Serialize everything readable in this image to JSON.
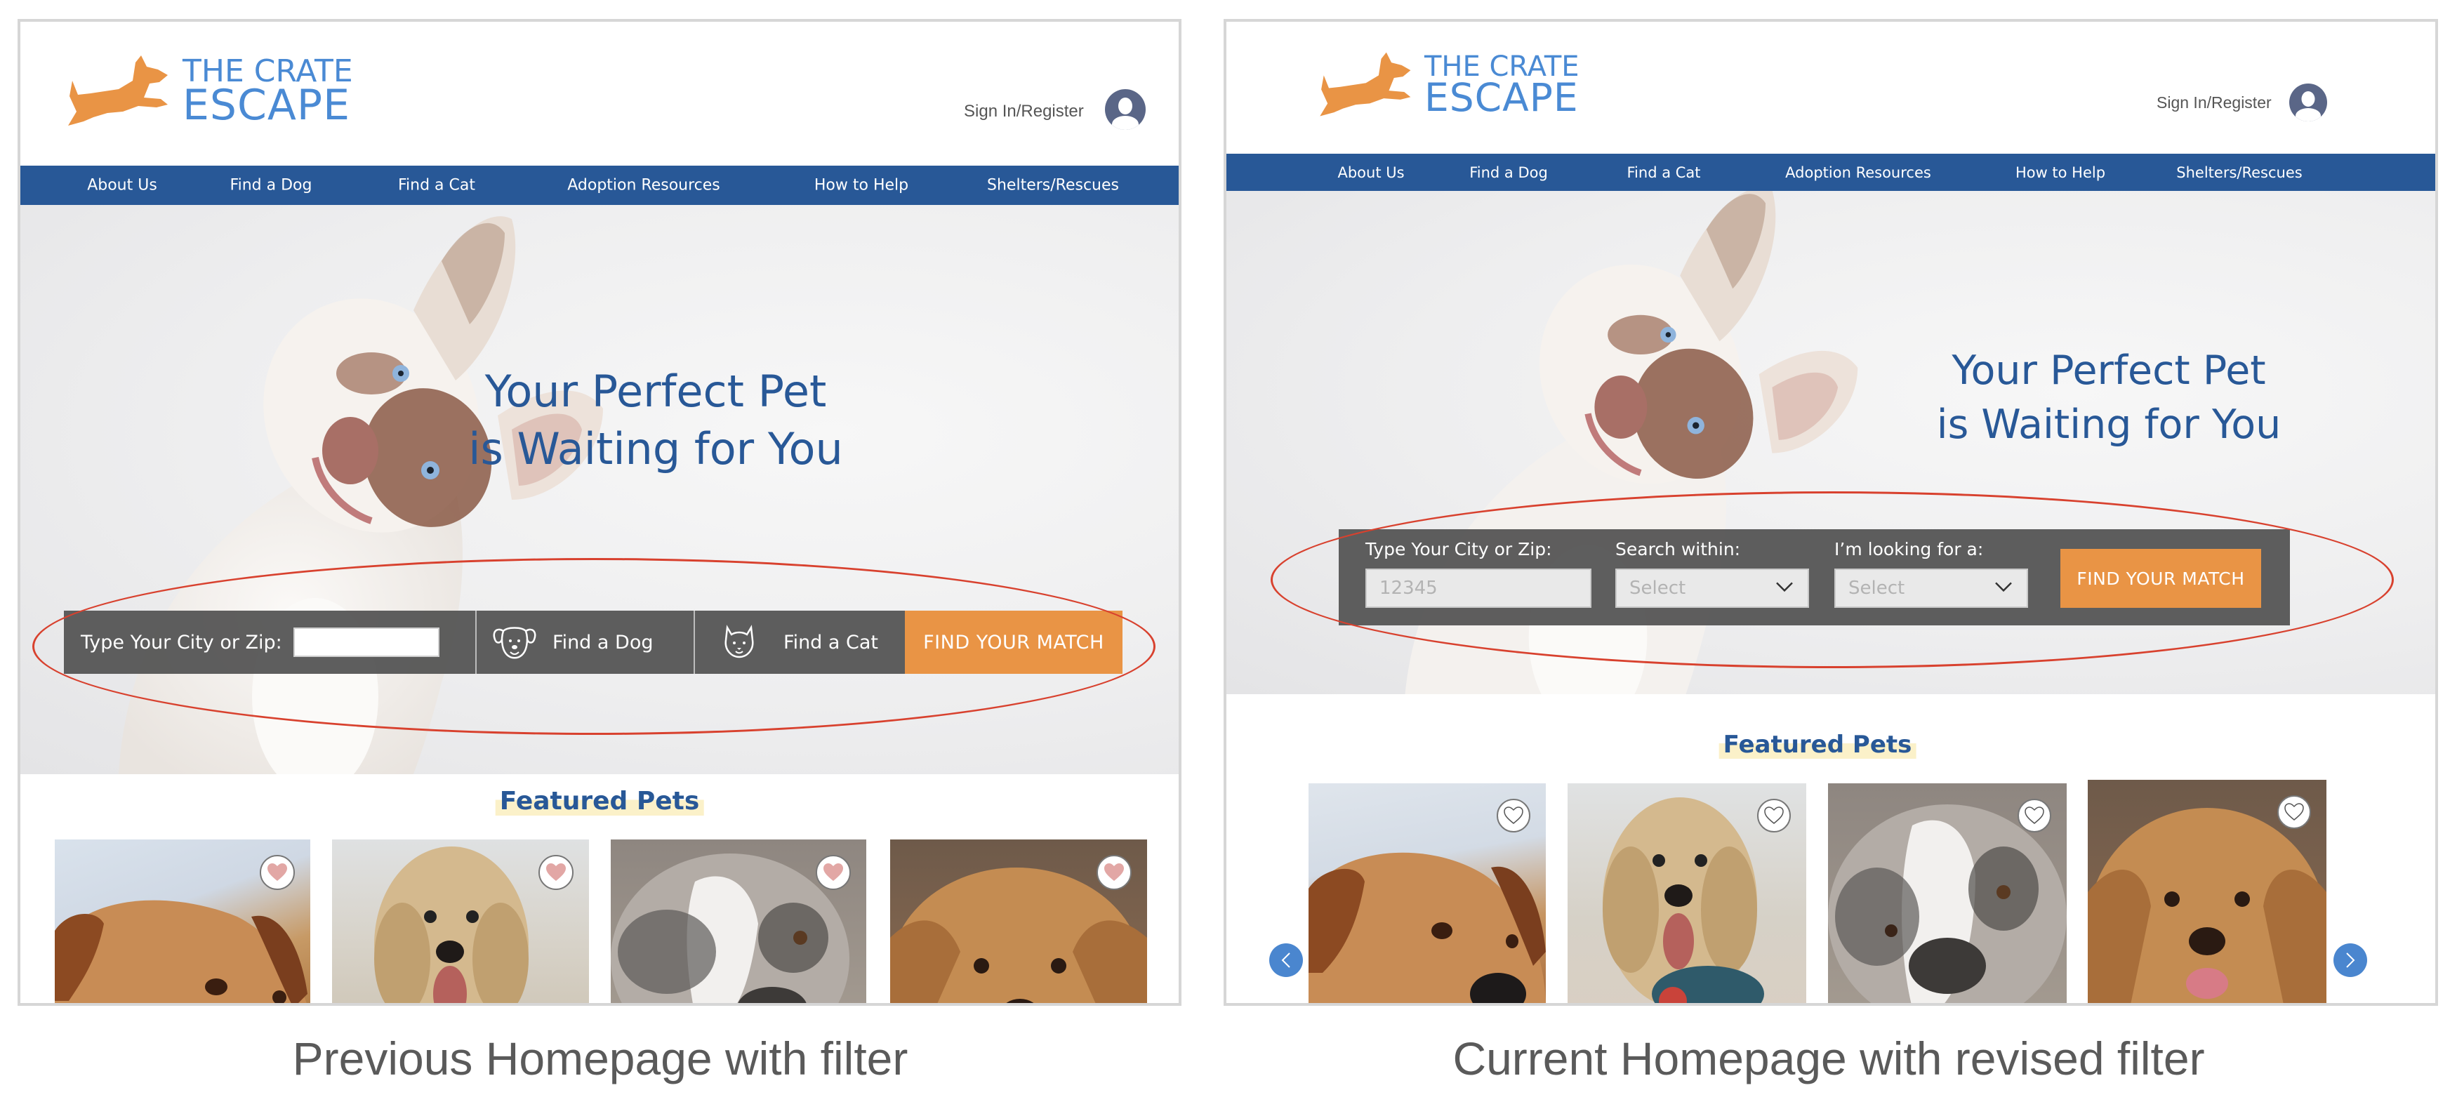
{
  "panels": {
    "previous": {
      "caption": "Previous Homepage with filter",
      "logo": {
        "line1": "THE CRATE",
        "line2": "ESCAPE"
      },
      "header": {
        "signin_label": "Sign In/Register"
      },
      "nav": [
        "About Us",
        "Find a Dog",
        "Find a Cat",
        "Adoption Resources",
        "How to Help",
        "Shelters/Rescues"
      ],
      "hero": {
        "headline_line1": "Your Perfect Pet",
        "headline_line2": "is Waiting for You"
      },
      "filter": {
        "zip_label": "Type Your City or Zip:",
        "zip_value": "",
        "dog_label": "Find a Dog",
        "cat_label": "Find a Cat",
        "submit_label": "FIND YOUR MATCH"
      },
      "featured_title": "Featured Pets",
      "pets": [
        {
          "favorited": true
        },
        {
          "favorited": true
        },
        {
          "favorited": true
        },
        {
          "favorited": true
        }
      ]
    },
    "current": {
      "caption": "Current Homepage with revised filter",
      "logo": {
        "line1": "THE CRATE",
        "line2": "ESCAPE"
      },
      "header": {
        "signin_label": "Sign In/Register"
      },
      "nav": [
        "About Us",
        "Find a Dog",
        "Find a Cat",
        "Adoption Resources",
        "How to Help",
        "Shelters/Rescues"
      ],
      "hero": {
        "headline_line1": "Your Perfect Pet",
        "headline_line2": "is Waiting for You"
      },
      "filter": {
        "zip_label": "Type Your City or Zip:",
        "zip_placeholder": "12345",
        "within_label": "Search within:",
        "within_value": "Select",
        "looking_label": "I’m looking for a:",
        "looking_value": "Select",
        "submit_label": "FIND YOUR MATCH"
      },
      "featured_title": "Featured Pets",
      "pets": [
        {
          "favorited": false
        },
        {
          "favorited": false
        },
        {
          "favorited": false
        },
        {
          "favorited": false
        }
      ],
      "carousel": {
        "prev_icon": "chevron-left-icon",
        "next_icon": "chevron-right-icon"
      }
    }
  },
  "colors": {
    "brand_blue": "#285897",
    "logo_blue": "#4a8ad4",
    "accent_orange": "#e99445",
    "highlight_red": "#d8412e",
    "heart_pink": "#e2a7a5",
    "carousel_blue": "#4a86cf"
  }
}
